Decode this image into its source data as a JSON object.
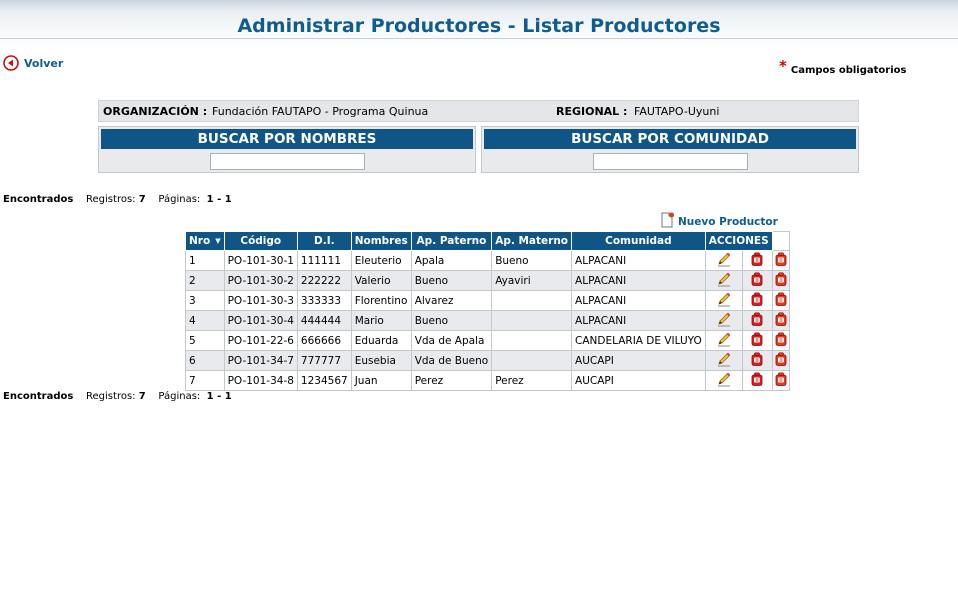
{
  "header": {
    "title": "Administrar Productores - Listar Productores"
  },
  "nav": {
    "back_label": "Volver"
  },
  "required_note": {
    "star": "*",
    "label": "Campos obligatorios"
  },
  "org": {
    "org_label": "ORGANIZACIÓN :",
    "org_value": "Fundación FAUTAPO - Programa Quinua",
    "regional_label": "REGIONAL :",
    "regional_value": "FAUTAPO-Uyuni"
  },
  "search": {
    "by_name_title": "BUSCAR POR NOMBRES",
    "by_name_value": "",
    "by_community_title": "BUSCAR POR COMUNIDAD",
    "by_community_value": ""
  },
  "stats": {
    "found_label": "Encontrados",
    "records_label": "Registros:",
    "records_value": "7",
    "pages_label": "Páginas:",
    "pages_value": "1 - 1"
  },
  "new_producer_label": "Nuevo Productor",
  "table": {
    "headers": [
      "Nro",
      "Código",
      "D.I.",
      "Nombres",
      "Ap. Paterno",
      "Ap. Materno",
      "Comunidad",
      "ACCIONES"
    ],
    "rows": [
      [
        "1",
        "PO-101-30-1",
        "111111",
        "Eleuterio",
        "Apala",
        "Bueno",
        "ALPACANI"
      ],
      [
        "2",
        "PO-101-30-2",
        "222222",
        "Valerio",
        "Bueno",
        "Ayaviri",
        "ALPACANI"
      ],
      [
        "3",
        "PO-101-30-3",
        "333333",
        "Florentino",
        "Alvarez",
        "",
        "ALPACANI"
      ],
      [
        "4",
        "PO-101-30-4",
        "444444",
        "Mario",
        "Bueno",
        "",
        "ALPACANI"
      ],
      [
        "5",
        "PO-101-22-6",
        "666666",
        "Eduarda",
        "Vda de Apala",
        "",
        "CANDELARIA DE VILUYO"
      ],
      [
        "6",
        "PO-101-34-7",
        "777777",
        "Eusebia",
        "Vda de Bueno",
        "",
        "AUCAPI"
      ],
      [
        "7",
        "PO-101-34-8",
        "1234567",
        "Juan",
        "Perez",
        "Perez",
        "AUCAPI"
      ]
    ],
    "action_icons": [
      "pencil-icon",
      "delete-icon",
      "delete-alt-icon"
    ]
  },
  "colors": {
    "header_blue": "#0f5687",
    "title_blue": "#0f5c8f",
    "required_red": "#d40000",
    "row_alt": "#e8eaed"
  }
}
